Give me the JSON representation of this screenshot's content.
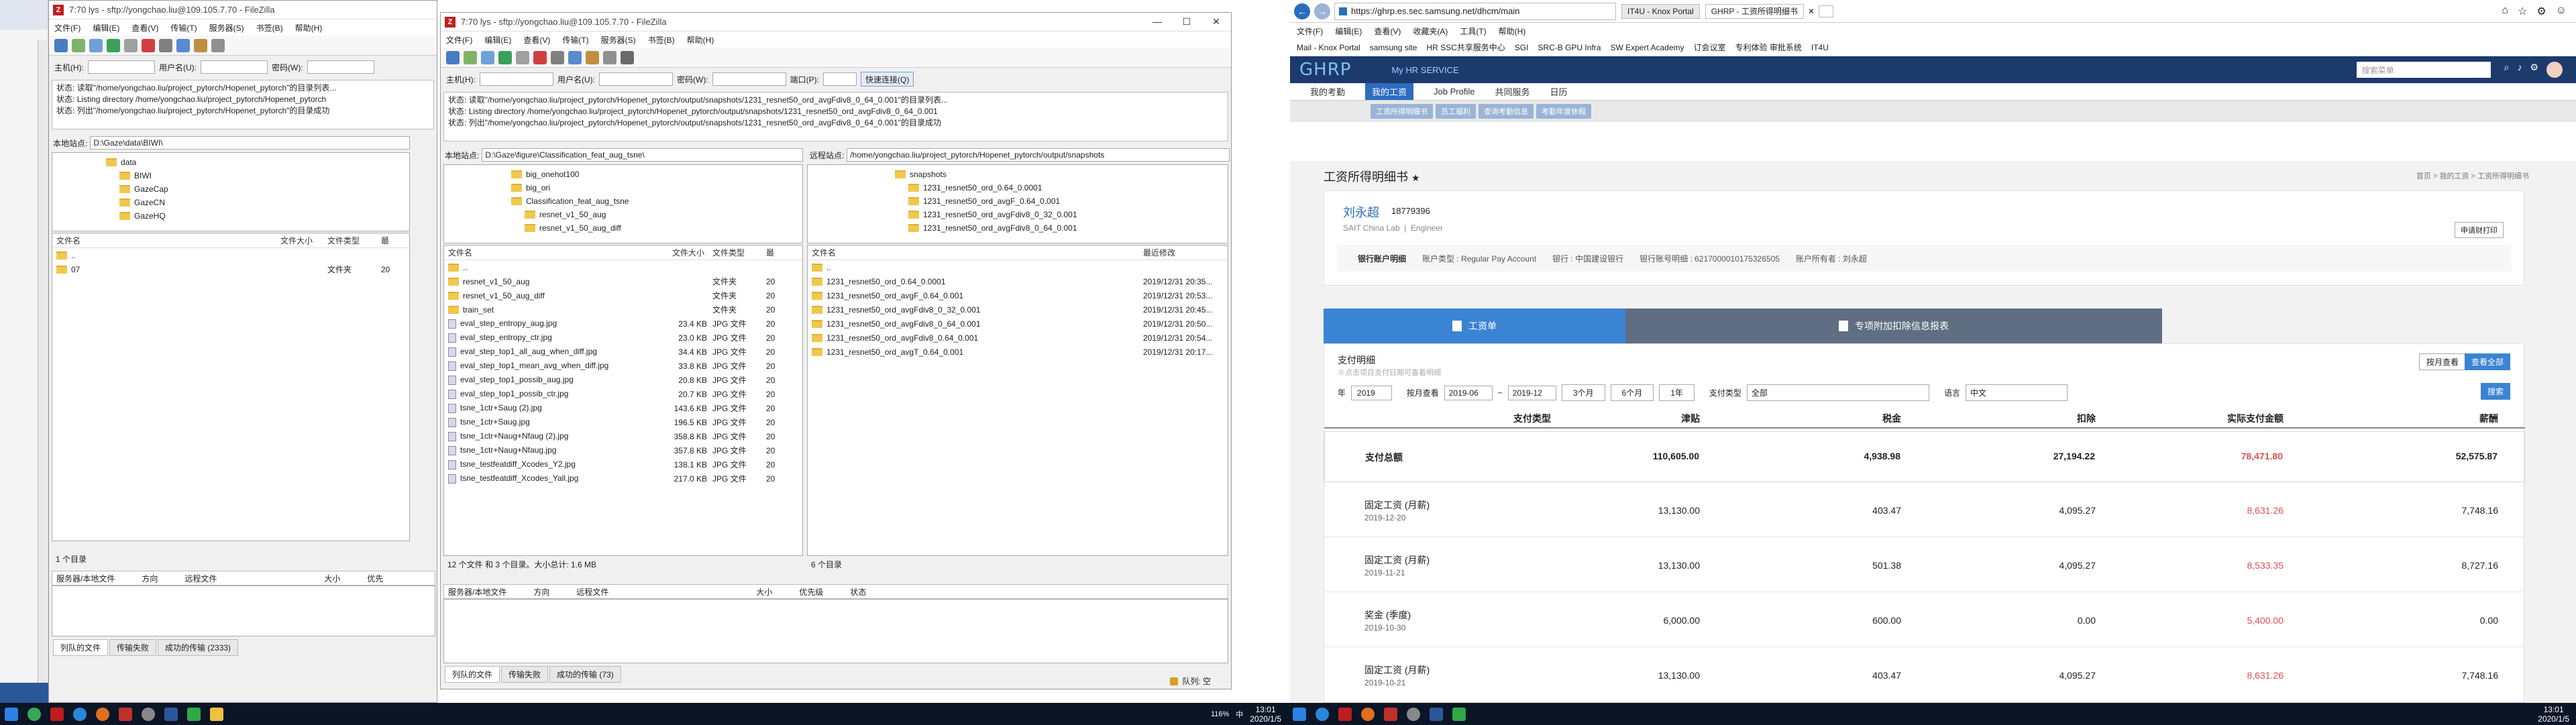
{
  "left_fz": {
    "title": "7:70 lys - sftp://yongchao.liu@109.105.7.70 - FileZilla",
    "menu": [
      "文件(F)",
      "编辑(E)",
      "查看(V)",
      "传输(T)",
      "服务器(S)",
      "书签(B)",
      "帮助(H)"
    ],
    "qc": {
      "host_label": "主机(H):",
      "user_label": "用户名(U):",
      "pass_label": "密码(W):"
    },
    "log": [
      {
        "k": "状态:",
        "v": "读取\"/home/yongchao.liu/project_pytorch/Hopenet_pytorch\"的目录列表..."
      },
      {
        "k": "状态:",
        "v": "Listing directory /home/yongchao.liu/project_pytorch/Hopenet_pytorch"
      },
      {
        "k": "状态:",
        "v": "列出\"/home/yongchao.liu/project_pytorch/Hopenet_pytorch\"的目录成功"
      }
    ],
    "local_label": "本地站点:",
    "local_path": "D:\\Gaze\\data\\BIWI\\",
    "tree": [
      "data",
      "BIWI",
      "GazeCap",
      "GazeCN",
      "GazeHQ"
    ],
    "list_headers": [
      "文件名",
      "文件大小",
      "文件类型",
      "最"
    ],
    "files": [
      {
        "name": "..",
        "size": "",
        "type": "",
        "m": ""
      },
      {
        "name": "07",
        "size": "",
        "type": "文件夹",
        "m": "20"
      }
    ],
    "status": "1 个目录",
    "queue_headers": [
      "服务器/本地文件",
      "方向",
      "远程文件",
      "大小",
      "优先"
    ],
    "queue_tabs": [
      "列队的文件",
      "传输失败",
      "成功的传输 (2333)"
    ]
  },
  "mid_fz": {
    "title": "7:70 lys - sftp://yongchao.liu@109.105.7.70 - FileZilla",
    "menu": [
      "文件(F)",
      "编辑(E)",
      "查看(V)",
      "传输(T)",
      "服务器(S)",
      "书签(B)",
      "帮助(H)"
    ],
    "qc": {
      "host_label": "主机(H):",
      "user_label": "用户名(U):",
      "pass_label": "密码(W):",
      "port_label": "端口(P):",
      "connect": "快速连接(Q)"
    },
    "log": [
      {
        "k": "状态:",
        "v": "读取\"/home/yongchao.liu/project_pytorch/Hopenet_pytorch/output/snapshots/1231_resnet50_ord_avgFdiv8_0_64_0.001\"的目录列表..."
      },
      {
        "k": "状态:",
        "v": "Listing directory /home/yongchao.liu/project_pytorch/Hopenet_pytorch/output/snapshots/1231_resnet50_ord_avgFdiv8_0_64_0.001"
      },
      {
        "k": "状态:",
        "v": "列出\"/home/yongchao.liu/project_pytorch/Hopenet_pytorch/output/snapshots/1231_resnet50_ord_avgFdiv8_0_64_0.001\"的目录成功"
      }
    ],
    "local_label": "本地站点:",
    "local_path": "D:\\Gaze\\figure\\Classification_feat_aug_tsne\\",
    "remote_label": "远程站点:",
    "remote_path": "/home/yongchao.liu/project_pytorch/Hopenet_pytorch/output/snapshots",
    "local_tree": [
      "big_onehot100",
      "big_ori",
      "Classification_feat_aug_tsne",
      "resnet_v1_50_aug",
      "resnet_v1_50_aug_diff"
    ],
    "remote_tree": [
      "snapshots",
      "1231_resnet50_ord_0.64_0.0001",
      "1231_resnet50_ord_avgF_0.64_0.001",
      "1231_resnet50_ord_avgFdiv8_0_32_0.001",
      "1231_resnet50_ord_avgFdiv8_0_64_0.001"
    ],
    "local_headers": [
      "文件名",
      "文件大小",
      "文件类型",
      "最"
    ],
    "local_files": [
      {
        "name": "..",
        "size": "",
        "type": "",
        "m": ""
      },
      {
        "name": "resnet_v1_50_aug",
        "size": "",
        "type": "文件夹",
        "m": "20"
      },
      {
        "name": "resnet_v1_50_aug_diff",
        "size": "",
        "type": "文件夹",
        "m": "20"
      },
      {
        "name": "train_set",
        "size": "",
        "type": "文件夹",
        "m": "20"
      },
      {
        "name": "eval_step_entropy_aug.jpg",
        "size": "23.4 KB",
        "type": "JPG 文件",
        "m": "20"
      },
      {
        "name": "eval_step_entropy_ctr.jpg",
        "size": "23.0 KB",
        "type": "JPG 文件",
        "m": "20"
      },
      {
        "name": "eval_step_top1_all_aug_when_diff.jpg",
        "size": "34.4 KB",
        "type": "JPG 文件",
        "m": "20"
      },
      {
        "name": "eval_step_top1_mean_avg_when_diff.jpg",
        "size": "33.8 KB",
        "type": "JPG 文件",
        "m": "20"
      },
      {
        "name": "eval_step_top1_possib_aug.jpg",
        "size": "20.8 KB",
        "type": "JPG 文件",
        "m": "20"
      },
      {
        "name": "eval_step_top1_possib_ctr.jpg",
        "size": "20.7 KB",
        "type": "JPG 文件",
        "m": "20"
      },
      {
        "name": "tsne_1ctr+Saug (2).jpg",
        "size": "143.6 KB",
        "type": "JPG 文件",
        "m": "20"
      },
      {
        "name": "tsne_1ctr+Saug.jpg",
        "size": "196.5 KB",
        "type": "JPG 文件",
        "m": "20"
      },
      {
        "name": "tsne_1ctr+Naug+Nfaug (2).jpg",
        "size": "358.8 KB",
        "type": "JPG 文件",
        "m": "20"
      },
      {
        "name": "tsne_1ctr+Naug+Nfaug.jpg",
        "size": "357.8 KB",
        "type": "JPG 文件",
        "m": "20"
      },
      {
        "name": "tsne_testfeatdiff_Xcodes_Y2.jpg",
        "size": "138.1 KB",
        "type": "JPG 文件",
        "m": "20"
      },
      {
        "name": "tsne_testfeatdiff_Xcodes_Yall.jpg",
        "size": "217.0 KB",
        "type": "JPG 文件",
        "m": "20"
      }
    ],
    "local_status": "12 个文件 和 3 个目录。大小总计: 1.6 MB",
    "remote_headers": [
      "文件名",
      "最近修改"
    ],
    "remote_files": [
      {
        "name": "..",
        "m": ""
      },
      {
        "name": "1231_resnet50_ord_0.64_0.0001",
        "m": "2019/12/31 20:35..."
      },
      {
        "name": "1231_resnet50_ord_avgF_0.64_0.001",
        "m": "2019/12/31 20:53..."
      },
      {
        "name": "1231_resnet50_ord_avgFdiv8_0_32_0.001",
        "m": "2019/12/31 20:45..."
      },
      {
        "name": "1231_resnet50_ord_avgFdiv8_0_64_0.001",
        "m": "2019/12/31 20:50..."
      },
      {
        "name": "1231_resnet50_ord_avgFdiv8_0.64_0.001",
        "m": "2019/12/31 20:54..."
      },
      {
        "name": "1231_resnet50_ord_avgT_0.64_0.001",
        "m": "2019/12/31 20:17..."
      }
    ],
    "remote_status": "6 个目录",
    "queue_headers": [
      "服务器/本地文件",
      "方向",
      "远程文件",
      "大小",
      "优先级",
      "状态"
    ],
    "queue_tabs": [
      "列队的文件",
      "传输失败",
      "成功的传输 (73)"
    ],
    "queue_status": "队列: 空"
  },
  "ie": {
    "url": "https://ghrp.es.sec.samsung.net/dhcm/main",
    "tabs": [
      "IT4U - Knox Portal",
      "GHRP - 工资所得明细书"
    ],
    "menu": [
      "文件(F)",
      "编辑(E)",
      "查看(V)",
      "收藏夹(A)",
      "工具(T)",
      "帮助(H)"
    ],
    "favorites": [
      "Mail - Knox Portal",
      "samsung site",
      "HR SSC共享服务中心",
      "SGI",
      "SRC-B GPU Infra",
      "SW Expert Academy",
      "订会议室",
      "专利体验 审批系统",
      "IT4U"
    ]
  },
  "ghrp": {
    "logo": "GHRP",
    "service": "My HR SERVICE",
    "search_placeholder": "搜索菜单",
    "nav": [
      "我的考勤",
      "我的工资",
      "Job Profile",
      "共同服务",
      "日历"
    ],
    "subtabs": [
      "工资所得明细书",
      "员工福利",
      "查询考勤信息",
      "考勤年度休假"
    ],
    "page_title": "工资所得明细书",
    "breadcrumb": "首页 > 我的工资 > 工资所得明细书",
    "name": "刘永超",
    "phone": "18779396",
    "org": "SAIT China Lab",
    "role": "Engineer",
    "print_btn": "申请财打印",
    "bank_btn": "银行账户明细",
    "acct_type": "账户类型 : Regular Pay Account",
    "bank": "银行 : 中国建设银行",
    "acct_no": "银行账号明细 : 6217000010175326505",
    "owner": "账户所有者 : 刘永超",
    "tab_salary": "工资单",
    "tab_special": "专项附加扣除信息报表",
    "section_title": "支付明细",
    "section_note": "※点击项目支付日期可查看明细",
    "btn_by_item": "按月查看",
    "btn_all": "查看全部",
    "f_year_label": "年",
    "f_year": "2019",
    "f_month_label": "按月查看",
    "f_from": "2019-06",
    "f_to": "2019-12",
    "f_3m": "3个月",
    "f_6m": "6个月",
    "f_1y": "1年",
    "f_type_label": "支付类型",
    "f_type": "全部",
    "f_lang_label": "语言",
    "f_lang": "中文",
    "f_search": "搜索",
    "cols": [
      "支付类型",
      "津贴",
      "税金",
      "扣除",
      "实际支付金额",
      "薪酬"
    ],
    "rows": [
      {
        "label": "支付总额",
        "date": "",
        "a": "110,605.00",
        "b": "4,938.98",
        "c": "27,194.22",
        "d": "78,471.80",
        "e": "52,575.87"
      },
      {
        "label": "固定工资 (月薪)",
        "date": "2019-12-20",
        "a": "13,130.00",
        "b": "403.47",
        "c": "4,095.27",
        "d": "8,631.26",
        "e": "7,748.16"
      },
      {
        "label": "固定工资 (月薪)",
        "date": "2019-11-21",
        "a": "13,130.00",
        "b": "501.38",
        "c": "4,095.27",
        "d": "8,533.35",
        "e": "8,727.16"
      },
      {
        "label": "奖金 (季度)",
        "date": "2019-10-30",
        "a": "6,000.00",
        "b": "600.00",
        "c": "0.00",
        "d": "5,400.00",
        "e": "0.00"
      },
      {
        "label": "固定工资 (月薪)",
        "date": "2019-10-21",
        "a": "13,130.00",
        "b": "403.47",
        "c": "4,095.27",
        "d": "8,631.26",
        "e": "7,748.16"
      }
    ]
  },
  "taskbar": {
    "left_time": "13:01",
    "left_date": "2020/1/5",
    "right_time": "13:01",
    "right_date": "2020/1/5",
    "input": "中",
    "notify": "116%"
  }
}
